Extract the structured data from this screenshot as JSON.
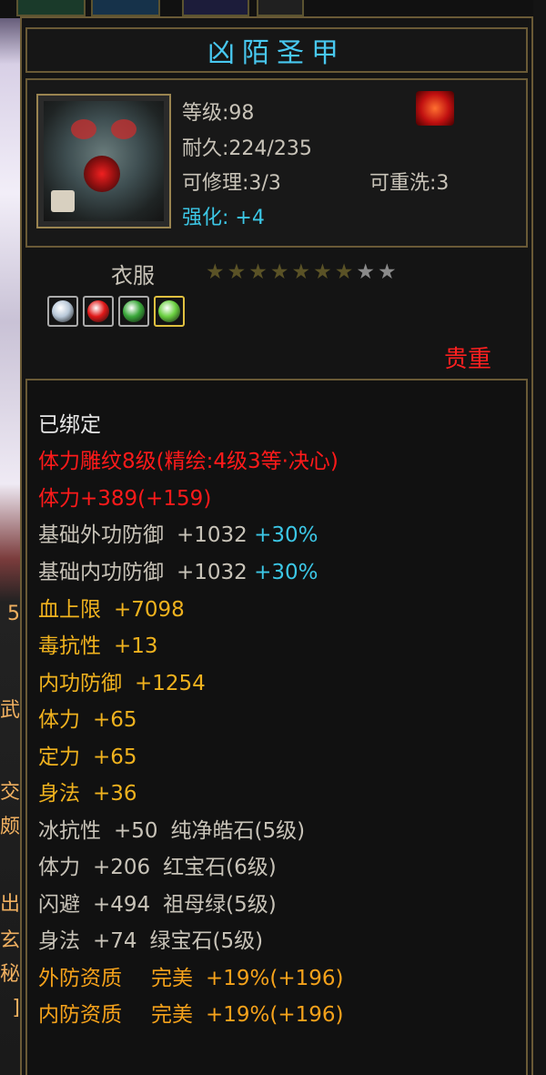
{
  "item": {
    "name": "凶陌圣甲",
    "level_label": "等级",
    "level": ":98",
    "durability_label": "耐久",
    "durability": ":224/235",
    "repair_label": "可修理",
    "repair": ":3/3",
    "reroll_label": "可重洗",
    "reroll": ":3",
    "enhance_label": "强化:",
    "enhance": "+4",
    "type": "衣服",
    "stars_filled": 7,
    "stars_total": 9,
    "rarity": "贵重"
  },
  "gems": [
    {
      "name": "pure-diamond-gem-icon",
      "color": "#b8c8d8"
    },
    {
      "name": "ruby-gem-icon",
      "color": "#e01818"
    },
    {
      "name": "emerald-gem-icon",
      "color": "#3aa83a"
    },
    {
      "name": "green-gem-icon",
      "color": "#6ad040"
    }
  ],
  "attributes": {
    "bound": "已绑定",
    "carving": "体力雕纹8级(精绘:4级3等·决心)",
    "stamina_bonus": "体力+389(+159)",
    "base_ext_def": {
      "label": "基础外功防御",
      "value": "+1032",
      "extra": "+30%"
    },
    "base_int_def": {
      "label": "基础内功防御",
      "value": "+1032",
      "extra": "+30%"
    },
    "hp_max": {
      "label": "血上限",
      "value": "+7098"
    },
    "poison_res": {
      "label": "毒抗性",
      "value": "+13"
    },
    "int_def": {
      "label": "内功防御",
      "value": "+1254"
    },
    "stamina": {
      "label": "体力",
      "value": "+65"
    },
    "focus": {
      "label": "定力",
      "value": "+65"
    },
    "agility": {
      "label": "身法",
      "value": "+36"
    },
    "gem_lines": [
      {
        "label": "冰抗性",
        "value": "+50",
        "gem": "纯净皓石(5级)"
      },
      {
        "label": "体力",
        "value": "+206",
        "gem": "红宝石(6级)"
      },
      {
        "label": "闪避",
        "value": "+494",
        "gem": "祖母绿(5级)"
      },
      {
        "label": "身法",
        "value": "+74",
        "gem": "绿宝石(5级)"
      }
    ],
    "quality_lines": [
      {
        "label": "外防资质",
        "grade": "完美",
        "value": "+19%(+196)"
      },
      {
        "label": "内防资质",
        "grade": "完美",
        "value": "+19%(+196)"
      }
    ]
  },
  "colors": {
    "title": "#48c8f0",
    "rarity": "#ff2020",
    "carving": "#ff1a1a",
    "gold_attr": "#f0b21e",
    "cyan_pct": "#3cc7e6",
    "border": "#6a5a36"
  },
  "side": {
    "left_chars": [
      "5",
      "武",
      "交",
      "颇",
      "出",
      "玄",
      "秘",
      "]"
    ]
  }
}
